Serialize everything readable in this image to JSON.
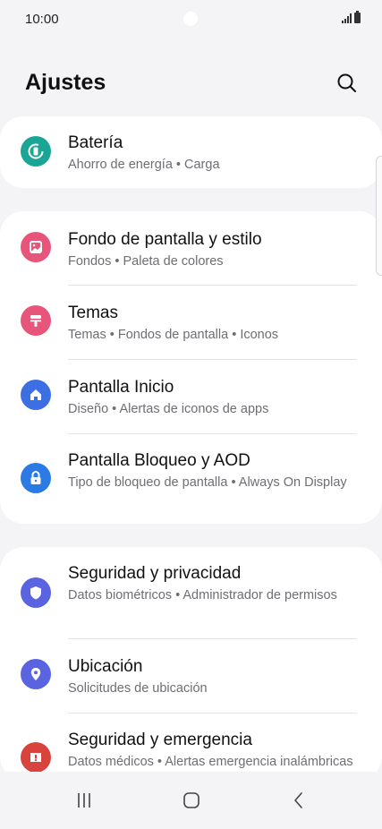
{
  "status_bar": {
    "time": "10:00"
  },
  "header": {
    "title": "Ajustes"
  },
  "sections": [
    {
      "items": [
        {
          "title": "Batería",
          "subtitle": "Ahorro de energía • Carga",
          "icon": "battery-icon",
          "color": "#1aa595"
        }
      ]
    },
    {
      "items": [
        {
          "title": "Fondo de pantalla y estilo",
          "subtitle": "Fondos • Paleta de colores",
          "icon": "wallpaper-icon",
          "color": "#e8557a"
        },
        {
          "title": "Temas",
          "subtitle": "Temas • Fondos de pantalla • Iconos",
          "icon": "themes-icon",
          "color": "#e8557a"
        },
        {
          "title": "Pantalla Inicio",
          "subtitle": "Diseño • Alertas de iconos de apps",
          "icon": "home-icon",
          "color": "#3d6fe4"
        },
        {
          "title": "Pantalla Bloqueo y AOD",
          "subtitle": "Tipo de bloqueo de pantalla • Always On Display",
          "icon": "lock-icon",
          "color": "#2c7be5"
        }
      ]
    },
    {
      "items": [
        {
          "title": "Seguridad y privacidad",
          "subtitle": "Datos biométricos • Administrador de permisos",
          "icon": "shield-icon",
          "color": "#5a63e0"
        },
        {
          "title": "Ubicación",
          "subtitle": "Solicitudes de ubicación",
          "icon": "location-icon",
          "color": "#5a63e0"
        },
        {
          "title": "Seguridad y emergencia",
          "subtitle": "Datos médicos • Alertas emergencia inalámbricas",
          "icon": "emergency-icon",
          "color": "#d9433d"
        }
      ]
    }
  ],
  "nav_bar": {
    "buttons": [
      "recent-apps",
      "home",
      "back"
    ]
  }
}
